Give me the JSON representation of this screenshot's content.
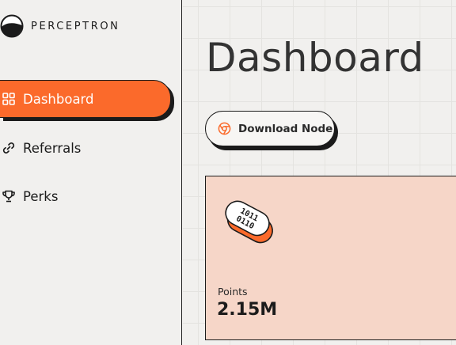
{
  "brand": {
    "name": "PERCEPTRON",
    "accent": "#fb6a2b"
  },
  "sidebar": {
    "items": [
      {
        "label": "Dashboard",
        "icon": "grid-icon",
        "active": true
      },
      {
        "label": "Referrals",
        "icon": "link-icon",
        "active": false
      },
      {
        "label": "Perks",
        "icon": "trophy-icon",
        "active": false
      }
    ]
  },
  "main": {
    "title": "Dashboard",
    "download_button": {
      "label": "Download Node",
      "icon": "chrome-icon"
    },
    "points_card": {
      "label": "Points",
      "value": "2.15M",
      "illustration": "binary-chip-icon",
      "chip_text_1": "1011",
      "chip_text_2": "0110",
      "background": "#f6d6c8"
    }
  }
}
